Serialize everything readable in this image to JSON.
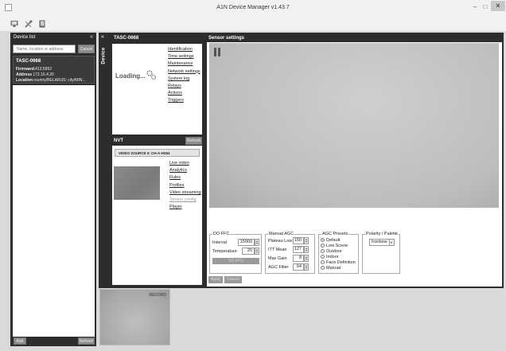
{
  "window": {
    "title": "A1N Device Manager v1.43.7",
    "minimize": "–",
    "maximize": "□",
    "close": "✕"
  },
  "toolbar": {
    "icons": [
      "monitor-icon",
      "tools-icon",
      "book-icon"
    ]
  },
  "device_list": {
    "title": "Device list",
    "collapse": "«",
    "search_placeholder": "Name, location or address",
    "cancel_label": "Cancel",
    "add_label": "Add",
    "refresh_label": "Refresh",
    "devices": [
      {
        "name": "TASC-0668",
        "firmware_label": "Firmware",
        "firmware": "1413.5952",
        "address_label": "Address",
        "address": "172.16.4.20",
        "location_label": "Location",
        "location": "country/BELARUS; city/MIN..."
      }
    ]
  },
  "device_panel": {
    "collapse": "«",
    "side_label": "Device",
    "title": "TASC-0668",
    "loading": "Loading...",
    "links": [
      "Identification",
      "Time settings",
      "Maintenance",
      "Network settings",
      "System log",
      "Relays",
      "Actions",
      "Triggers"
    ],
    "nvt": {
      "title": "NVT",
      "refresh_label": "Refresh",
      "video_source": "VIDEO SOURCE 0: CH-A-H264",
      "links": [
        "Live video",
        "Analytics",
        "Rules",
        "Profiles",
        "Video streaming",
        "Sensor config",
        "Player"
      ]
    }
  },
  "sensor": {
    "title": "Sensor settings",
    "do_ffc": {
      "legend": "DO FFC",
      "interval_label": "Interval",
      "interval": "15000",
      "temperature_label": "Temperature",
      "temperature": "20",
      "button": "DO FFC"
    },
    "manual_agc": {
      "legend": "Manual AGC",
      "plateau_label": "Plateau Low",
      "plateau": "150",
      "itt_label": "ITT Mean",
      "itt": "127",
      "maxgain_label": "Max Gain",
      "maxgain": "8",
      "agcfilter_label": "AGC Filter",
      "agcfilter": "64"
    },
    "agc_presets": {
      "legend": "AGC Presets",
      "options": [
        "Default",
        "Low Scene",
        "Outdoor",
        "Indoor",
        "Face Definition",
        "Manual"
      ],
      "selected": "Default"
    },
    "polarity": {
      "legend": "Polarity / Palette",
      "value": "Ironbow 1"
    },
    "apply_label": "Apply",
    "cancel_label": "Cancel"
  },
  "record": {
    "label": "RECORD"
  }
}
